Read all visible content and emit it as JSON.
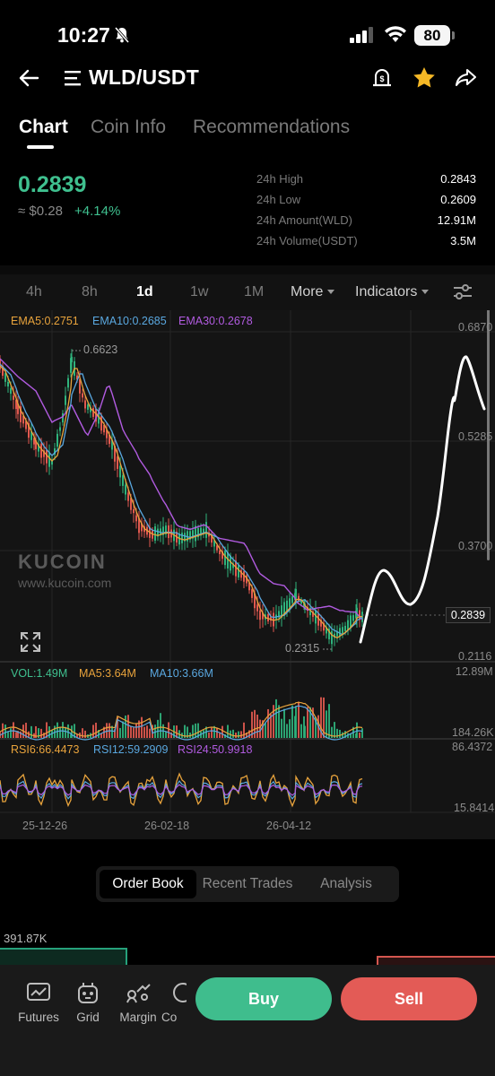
{
  "status_bar": {
    "time": "10:27",
    "battery": "80"
  },
  "header": {
    "pair": "WLD/USDT"
  },
  "tabs": [
    {
      "label": "Chart",
      "active": true
    },
    {
      "label": "Coin Info",
      "active": false
    },
    {
      "label": "Recommendations",
      "active": false
    }
  ],
  "price_panel": {
    "last_price": "0.2839",
    "fiat_price": "≈ $0.28",
    "change": "+4.14%",
    "stats": [
      {
        "label": "24h High",
        "value": "0.2843"
      },
      {
        "label": "24h Low",
        "value": "0.2609"
      },
      {
        "label": "24h Amount(WLD)",
        "value": "12.91M"
      },
      {
        "label": "24h Volume(USDT)",
        "value": "3.5M"
      }
    ]
  },
  "intervals": [
    {
      "label": "4h",
      "active": false
    },
    {
      "label": "8h",
      "active": false
    },
    {
      "label": "1d",
      "active": true
    },
    {
      "label": "1w",
      "active": false
    },
    {
      "label": "1M",
      "active": false
    },
    {
      "label": "More",
      "active": false
    },
    {
      "label": "Indicators",
      "active": false
    }
  ],
  "chart": {
    "ema_labels": [
      "EMA5:0.2751",
      "EMA10:0.2685",
      "EMA30:0.2678"
    ],
    "price_axis": [
      "0.6870",
      "0.5285",
      "0.3700",
      "0.2116"
    ],
    "current_price": "0.2839",
    "high_marker": "0.6623",
    "low_marker": "0.2315",
    "watermark_brand": "KUCOIN",
    "watermark_url": "www.kucoin.com",
    "vol_labels": [
      "VOL:1.49M",
      "MA5:3.64M",
      "MA10:3.66M"
    ],
    "vol_axis": [
      "12.89M",
      "184.26K"
    ],
    "rsi_labels": [
      "RSI6:66.4473",
      "RSI12:59.2909",
      "RSI24:50.9918"
    ],
    "rsi_axis": [
      "86.4372",
      "15.8414"
    ],
    "date_axis": [
      "25-12-26",
      "26-02-18",
      "26-04-12"
    ],
    "colors": {
      "ema5": "#e8a33c",
      "ema10": "#5aa8e0",
      "ema30": "#b15be0",
      "up": "#2fb37c",
      "down": "#e0594f"
    }
  },
  "orderbook": {
    "tabs": [
      {
        "label": "Order Book",
        "active": true
      },
      {
        "label": "Recent Trades",
        "active": false
      },
      {
        "label": "Analysis",
        "active": false
      }
    ],
    "depth_label": "391.87K"
  },
  "bottom_bar": {
    "items": [
      {
        "label": "Futures",
        "icon": "futures-chart-icon"
      },
      {
        "label": "Grid",
        "icon": "grid-bot-icon"
      },
      {
        "label": "Margin",
        "icon": "margin-icon"
      },
      {
        "label": "Co",
        "icon": "copy-trading-icon"
      }
    ],
    "buy_label": "Buy",
    "sell_label": "Sell"
  }
}
